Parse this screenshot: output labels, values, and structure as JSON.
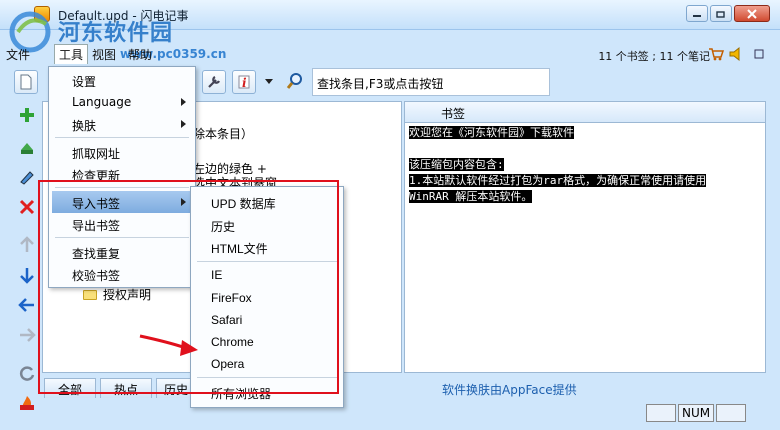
{
  "window": {
    "title": "Default.upd - 闪电记事",
    "watermark_title": "河东软件园",
    "watermark_url": "www.pc0359.cn"
  },
  "menubar": {
    "items": [
      "文件",
      "工具",
      "视图",
      "帮助"
    ],
    "counts": "11 个书签 ; 11 个笔记"
  },
  "toolbar": {
    "search_text": "查找条目,F3或点击按钮"
  },
  "tree": {
    "partial_1": "除本条目）",
    "partial_2": "左边的绿色 +",
    "partial_3": "选中文本到悬窗",
    "item_license": "授权声明"
  },
  "notes": {
    "header": "书签",
    "lines": [
      "欢迎您在《河东软件园》下载软件",
      "",
      "该压缩包内容包含:",
      "1.本站默认软件经过打包为rar格式，为确保正常使用请使用",
      "WinRAR 解压本站软件。"
    ]
  },
  "tools_menu": {
    "items": [
      "设置",
      "Language",
      "换肤",
      "抓取网址",
      "检查更新",
      "导入书签",
      "导出书签",
      "查找重复",
      "校验书签"
    ],
    "selected_index": 5
  },
  "import_submenu": {
    "items": [
      "UPD 数据库",
      "历史",
      "HTML文件",
      "IE",
      "FireFox",
      "Safari",
      "Chrome",
      "Opera",
      "所有浏览器"
    ]
  },
  "bottom_tabs": [
    "全部",
    "热点",
    "历史"
  ],
  "skin_credit": "软件换肤由AppFace提供",
  "status": {
    "num": "NUM"
  },
  "colors": {
    "highlight_box": "#e0101c",
    "selected_menu": "#7eacdf",
    "watermark": "#2a78c8"
  }
}
